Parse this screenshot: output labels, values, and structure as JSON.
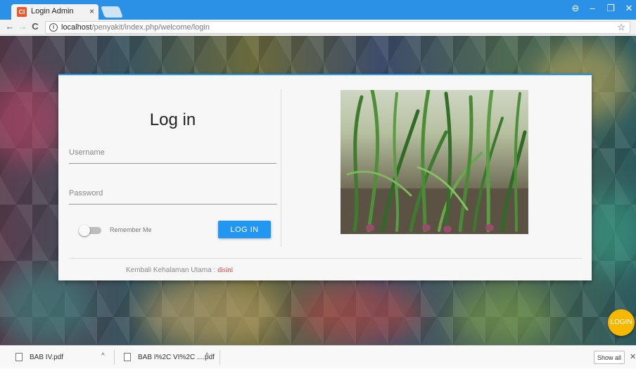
{
  "browser": {
    "tab_title": "Login Admin",
    "tab_favicon": "CI",
    "tab_close": "×",
    "url_host": "localhost",
    "url_path": "/penyakit/index.php/welcome/login",
    "back_glyph": "←",
    "forward_glyph": "→",
    "reload_glyph": "C",
    "info_glyph": "i",
    "star_glyph": "☆",
    "account_glyph": "⊖",
    "minimize_glyph": "–",
    "restore_glyph": "❐",
    "close_glyph": "✕",
    "accent_color": "#2b91e6"
  },
  "login": {
    "title": "Log in",
    "username_placeholder": "Username",
    "password_placeholder": "Password",
    "remember_label": "Remember Me",
    "remember_on": false,
    "submit_label": "LOG IN",
    "back_prefix": "Kembali Kehalaman Utama : ",
    "back_link": "disini",
    "primary_color": "#2196f3"
  },
  "fab": {
    "label": "LOGIN",
    "color": "#f6b800"
  },
  "downloads": {
    "items": [
      {
        "name": "BAB IV.pdf"
      },
      {
        "name": "BAB I%2C VI%2C ....pdf"
      }
    ],
    "caret": "^",
    "show_all_label": "Show all",
    "close_glyph": "✕"
  }
}
